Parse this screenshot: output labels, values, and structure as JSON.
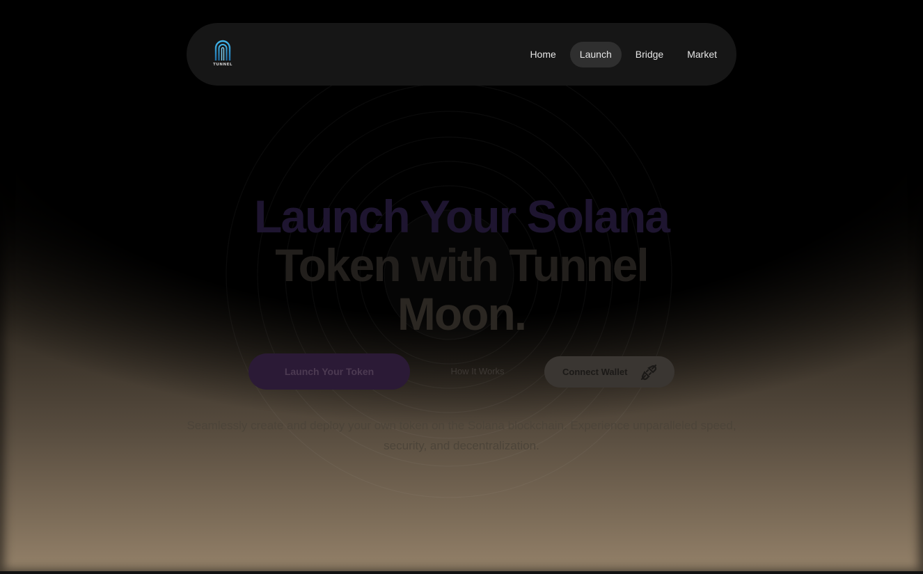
{
  "brand": {
    "logo_text": "TUNNEL",
    "accent_color": "#3aa0d8"
  },
  "nav": {
    "items": [
      {
        "label": "Home",
        "active": false
      },
      {
        "label": "Launch",
        "active": true
      },
      {
        "label": "Bridge",
        "active": false
      },
      {
        "label": "Market",
        "active": false
      }
    ]
  },
  "hero": {
    "title_line1": "Launch Your Solana",
    "title_line2": "Token with Tunnel",
    "title_line3": "Moon.",
    "subtitle": "Seamlessly create and deploy your own token on the Solana blockchain. Experience unparalleled speed, security, and decentralization."
  },
  "actions": {
    "launch_label": "Launch Your Token",
    "how_label": "How It Works",
    "wallet_label": "Connect Wallet",
    "wallet_icon": "plug-icon"
  }
}
